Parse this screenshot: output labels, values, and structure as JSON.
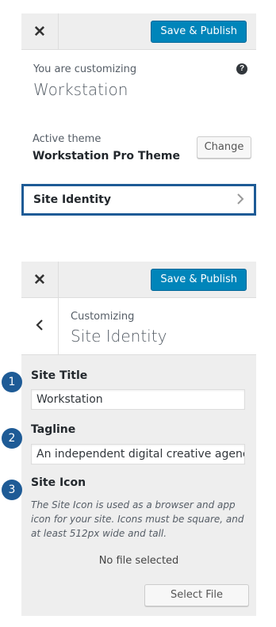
{
  "top_panel": {
    "close_icon": "close-icon",
    "save_label": "Save & Publish",
    "customizing_label": "You are customizing",
    "site_name": "Workstation",
    "help_icon": "question-circle-icon",
    "active_theme_label": "Active theme",
    "theme_name": "Workstation Pro Theme",
    "change_label": "Change",
    "section_label": "Site Identity",
    "chevron_icon": "chevron-right-icon"
  },
  "bottom_panel": {
    "close_icon": "close-icon",
    "save_label": "Save & Publish",
    "back_icon": "chevron-left-icon",
    "customizing_label": "Customizing",
    "section_title": "Site Identity",
    "fields": [
      {
        "step": "1",
        "label": "Site Title",
        "value": "Workstation"
      },
      {
        "step": "2",
        "label": "Tagline",
        "value": "An independent digital creative agency l"
      },
      {
        "step": "3",
        "label": "Site Icon"
      }
    ],
    "site_icon_description": "The Site Icon is used as a browser and app icon for your site. Icons must be square, and at least 512px wide and tall.",
    "no_file_text": "No file selected",
    "select_file_label": "Select File"
  },
  "colors": {
    "primary_button": "#0085ba",
    "highlight_border": "#1e5b96",
    "step_badge": "#1e5b96",
    "arrow": "#1e5b96"
  }
}
